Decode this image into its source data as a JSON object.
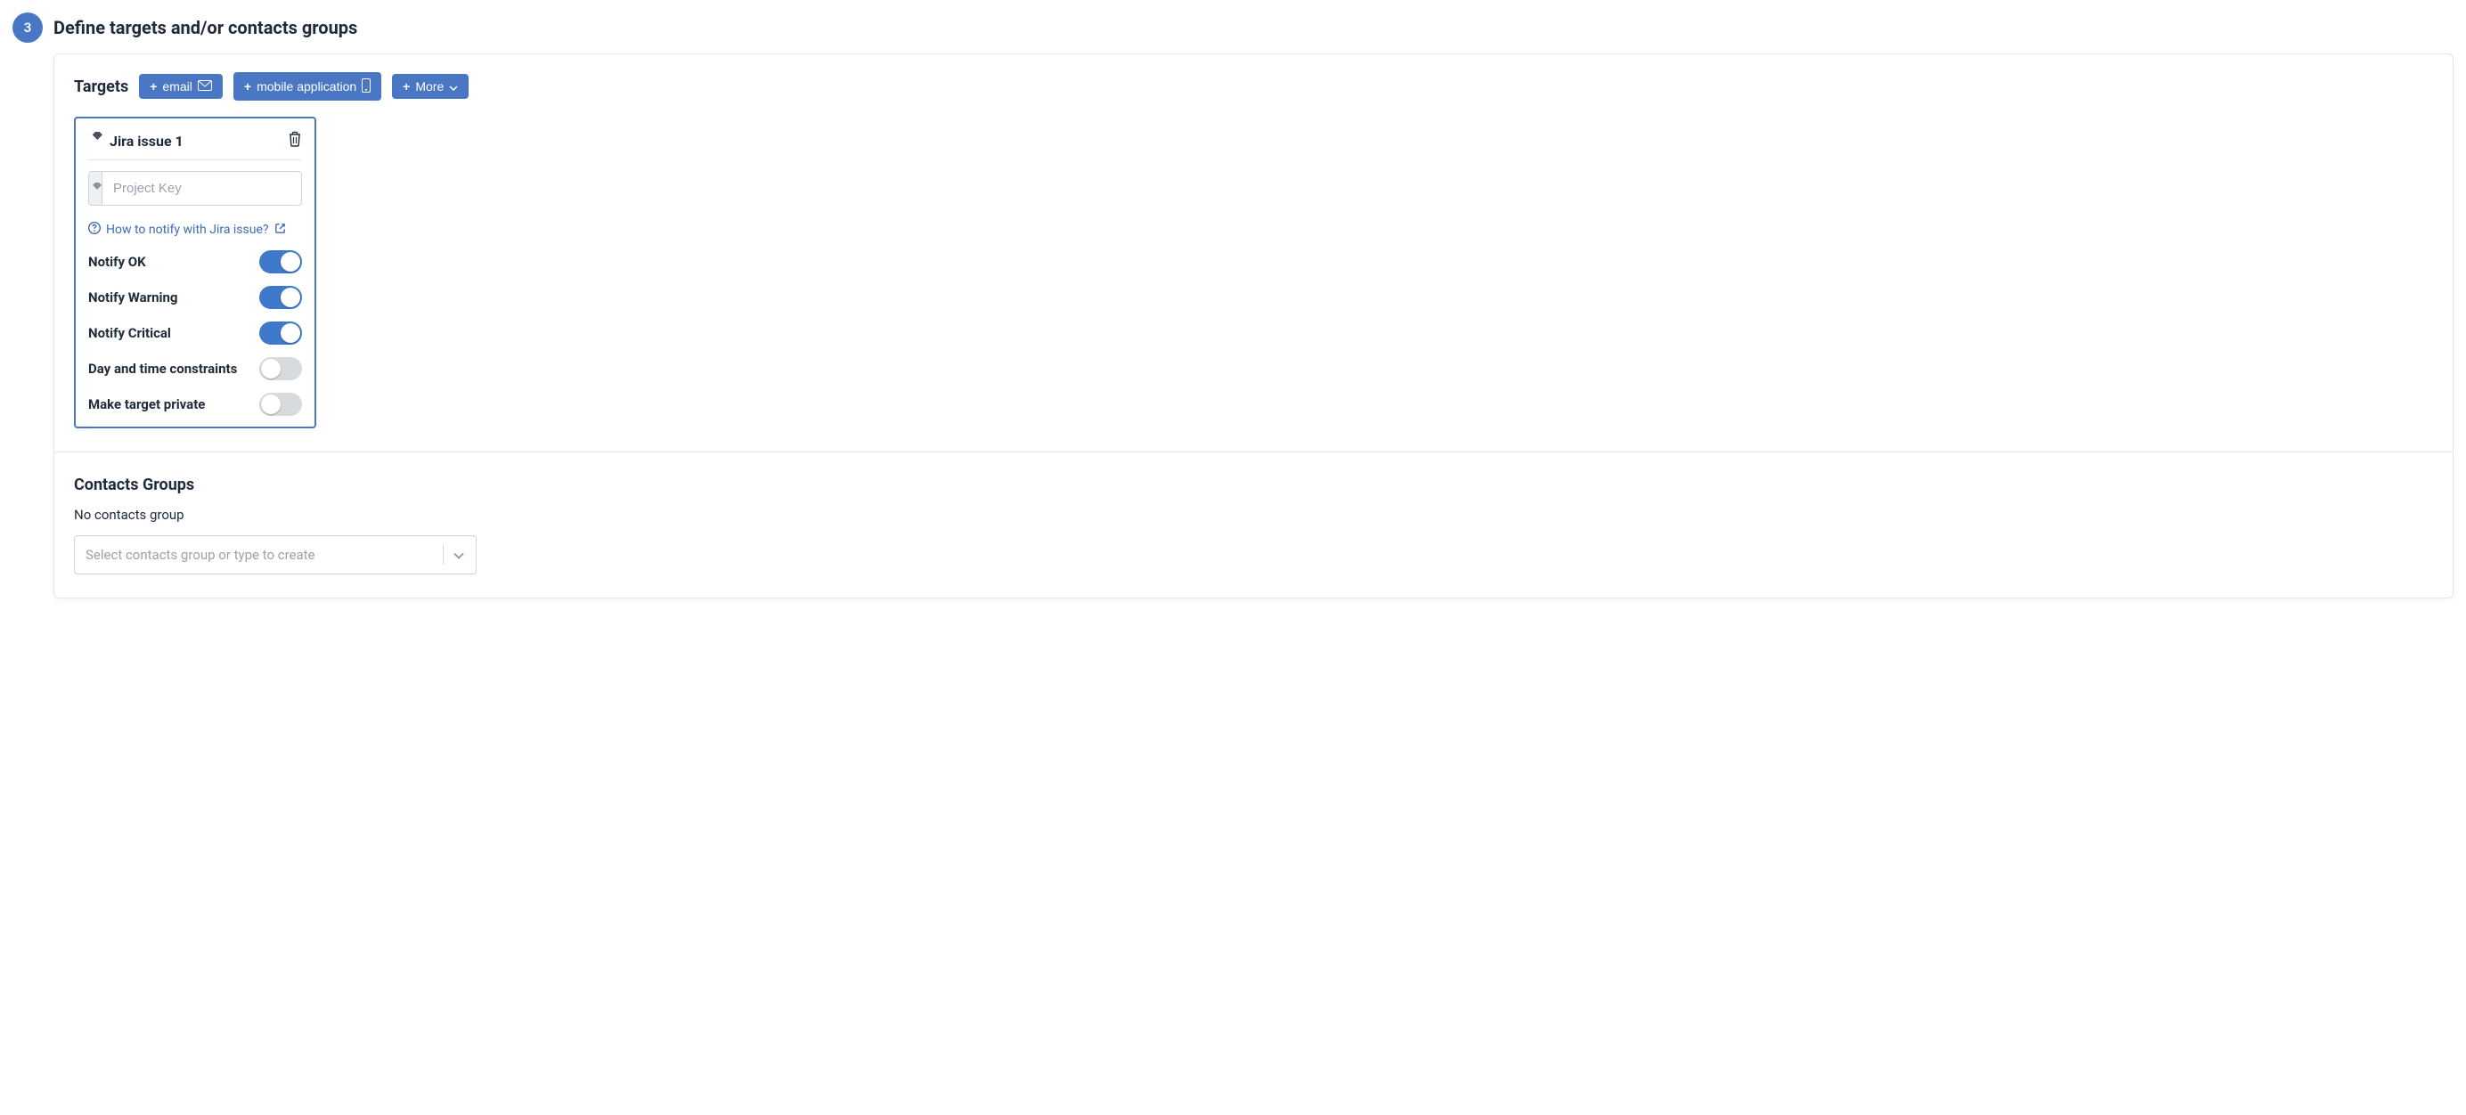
{
  "step": {
    "number": "3",
    "title": "Define targets and/or contacts groups"
  },
  "targets": {
    "heading": "Targets",
    "buttons": {
      "email": "email",
      "mobile": "mobile application",
      "more": "More"
    },
    "card": {
      "title": "Jira issue 1",
      "project_key_placeholder": "Project Key",
      "help_text": "How to notify with Jira issue?",
      "toggles": {
        "notify_ok": {
          "label": "Notify OK",
          "on": true
        },
        "notify_warning": {
          "label": "Notify Warning",
          "on": true
        },
        "notify_critical": {
          "label": "Notify Critical",
          "on": true
        },
        "time_constraints": {
          "label": "Day and time constraints",
          "on": false
        },
        "private": {
          "label": "Make target private",
          "on": false
        }
      }
    }
  },
  "contacts": {
    "heading": "Contacts Groups",
    "empty_line": "No contacts group",
    "select_placeholder": "Select contacts group or type to create"
  }
}
